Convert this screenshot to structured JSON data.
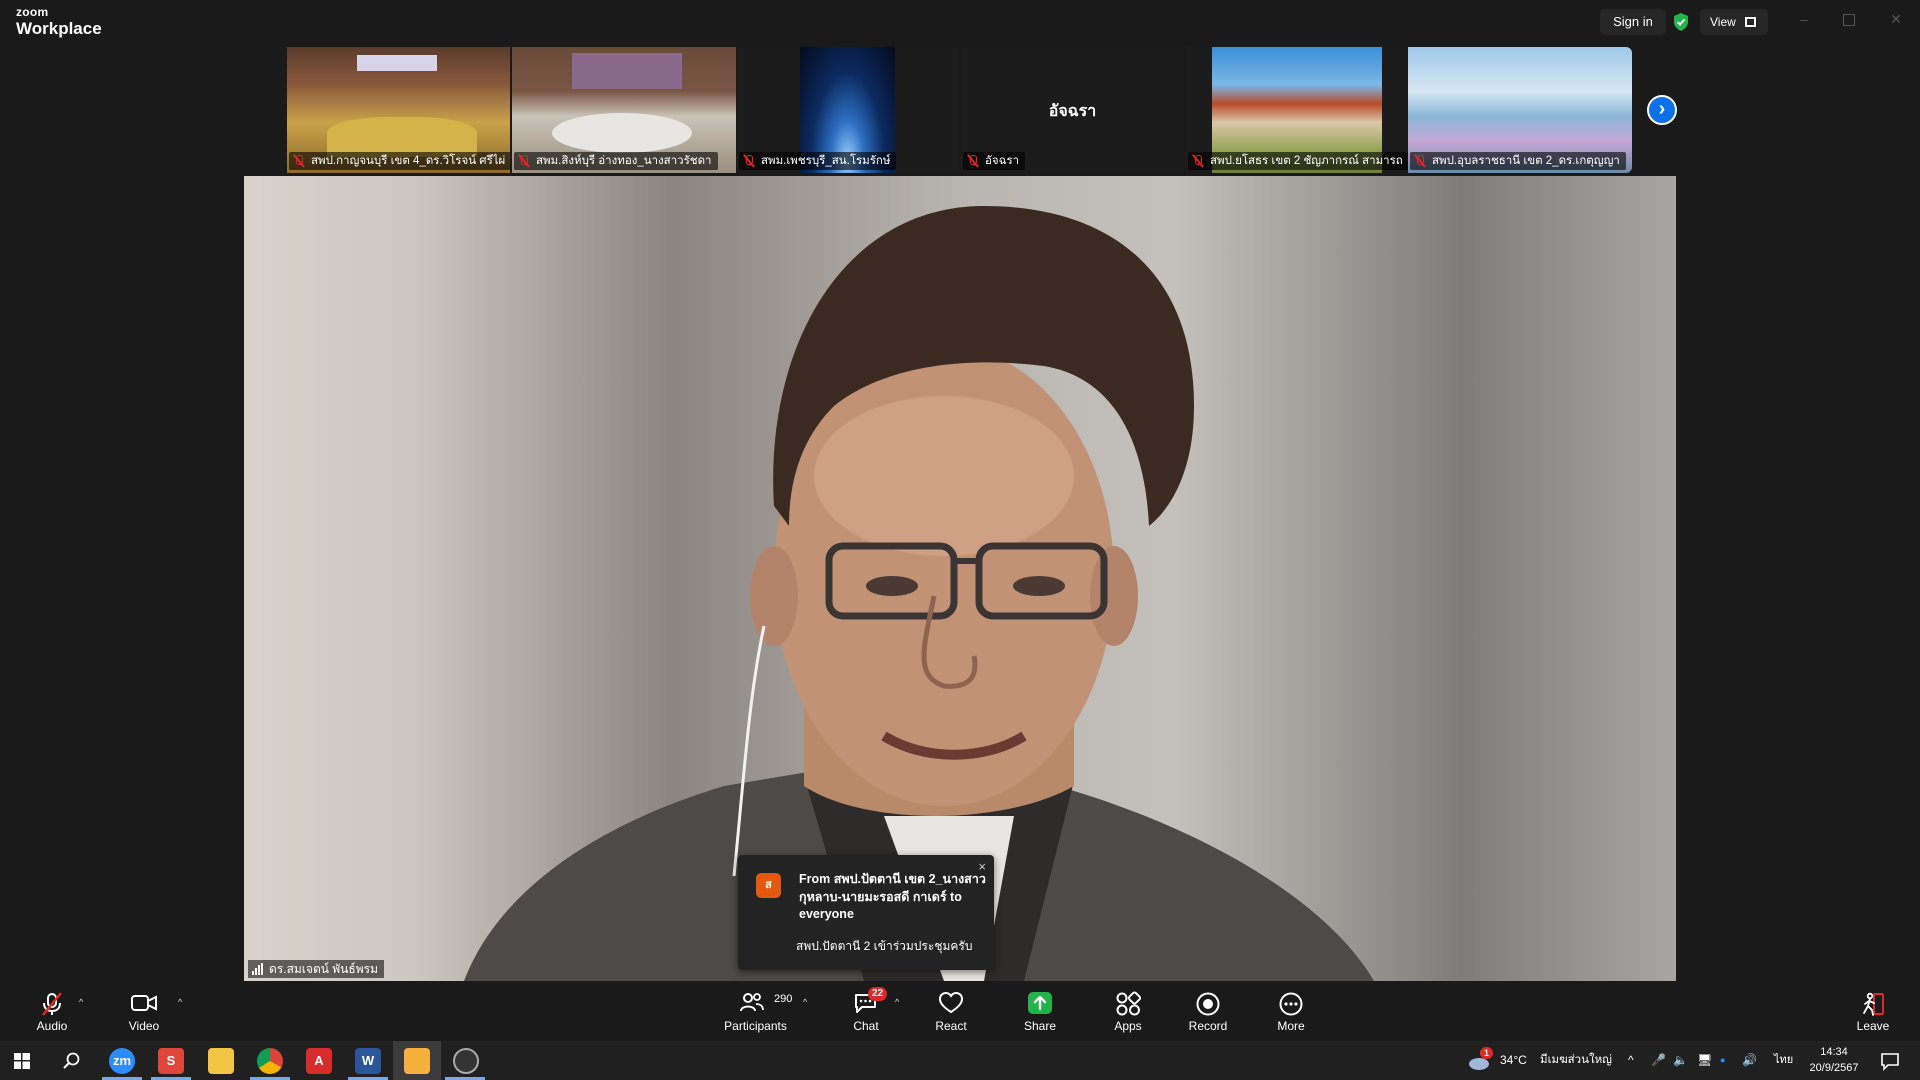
{
  "app": {
    "brand_small": "zoom",
    "brand_big": "Workplace"
  },
  "header": {
    "sign_in": "Sign in",
    "view": "View",
    "shield_color": "#23b34a"
  },
  "thumbnails": [
    {
      "name": "สพป.กาญจนบุรี เขต 4_ดร.วิโรจน์ ศรีไผ่",
      "muted": true
    },
    {
      "name": "สพม.สิงห์บุรี อ่างทอง_นางสาวรัชดา",
      "muted": true
    },
    {
      "name": "สพม.เพชรบุรี_สน.โรมรักษ์",
      "muted": true
    },
    {
      "name": "อัจฉรา",
      "muted": true,
      "display_text": "อัจฉรา"
    },
    {
      "name": "สพป.ยโสธร เขต 2 ชัญภากรณ์ สามารถ",
      "muted": true
    },
    {
      "name": "สพป.อุบลราชธานี เขต 2_ดร.เกตุญญา",
      "muted": true
    }
  ],
  "main_video": {
    "participant_name": "ดร.สมเจตน์ พันธ์พรม"
  },
  "chat_popup": {
    "avatar_letter": "ส",
    "from_text": "From สพป.ปัตตานี เขต 2_นางสาวกุหลาบ-นายมะรอสดี กาเดร์ to everyone",
    "message": "สพป.ปัตตานี 2 เข้าร่วมประชุมครับ",
    "close": "×"
  },
  "toolbar": {
    "audio": "Audio",
    "video": "Video",
    "participants": "Participants",
    "participants_count": "290",
    "chat": "Chat",
    "chat_badge": "22",
    "react": "React",
    "share": "Share",
    "apps": "Apps",
    "record": "Record",
    "more": "More",
    "leave": "Leave"
  },
  "taskbar": {
    "apps": [
      "start-icon",
      "search-icon",
      "zoom-icon",
      "s-app-icon",
      "file-explorer-icon",
      "chrome-icon",
      "acrobat-icon",
      "word-icon",
      "orange-app-icon",
      "obs-icon"
    ],
    "weather": "34°C",
    "weather_desc": "มีเมฆส่วนใหญ่",
    "weather_badge": "1",
    "language": "ไทย",
    "time": "14:34",
    "date": "20/9/2567"
  },
  "colors": {
    "accent": "#0e71eb",
    "muted_red": "#e02828",
    "share_green": "#23b34a",
    "popup_avatar": "#e2590f"
  }
}
